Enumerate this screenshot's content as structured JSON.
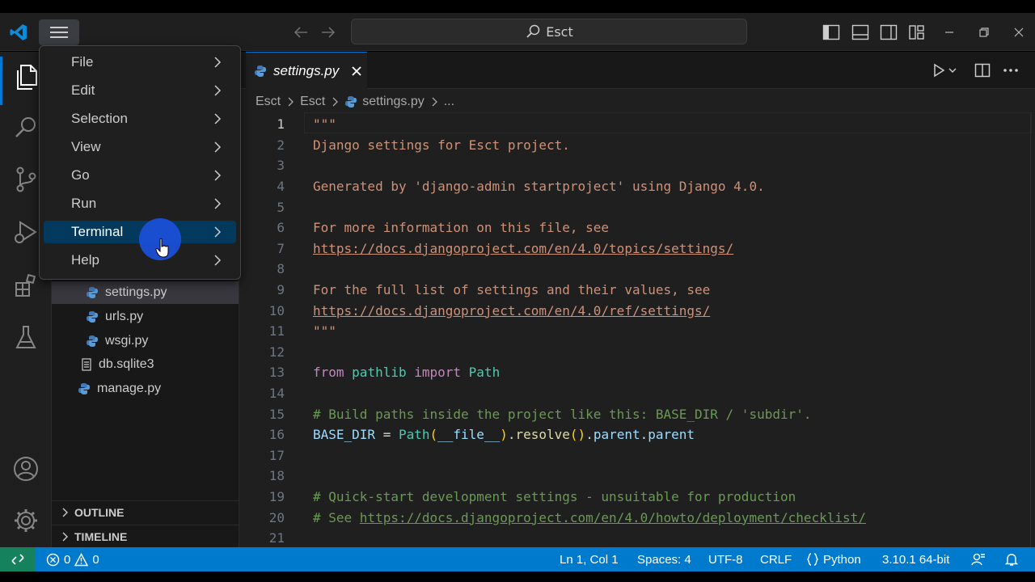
{
  "colors": {
    "accent": "#0078d4",
    "statusbar": "#007acc",
    "remote": "#16825d",
    "menu_highlight": "#04395e"
  },
  "titlebar": {
    "search_text": "Esct"
  },
  "menu": {
    "items": [
      {
        "label": "File"
      },
      {
        "label": "Edit"
      },
      {
        "label": "Selection"
      },
      {
        "label": "View"
      },
      {
        "label": "Go"
      },
      {
        "label": "Run"
      },
      {
        "label": "Terminal"
      },
      {
        "label": "Help"
      }
    ],
    "highlighted": "Terminal"
  },
  "explorer": {
    "files": [
      {
        "name": "settings.py",
        "icon": "python-icon",
        "selected": true
      },
      {
        "name": "urls.py",
        "icon": "python-icon"
      },
      {
        "name": "wsgi.py",
        "icon": "python-icon"
      },
      {
        "name": "db.sqlite3",
        "icon": "database-icon"
      },
      {
        "name": "manage.py",
        "icon": "python-icon"
      }
    ],
    "outline_label": "OUTLINE",
    "timeline_label": "TIMELINE"
  },
  "editor": {
    "tab_label": "settings.py",
    "breadcrumbs": [
      "Esct",
      "Esct",
      "settings.py",
      "..."
    ],
    "active_line": 1,
    "lines": [
      {
        "n": "1",
        "tokens": [
          {
            "t": "\"\"\"",
            "c": "s"
          }
        ]
      },
      {
        "n": "2",
        "tokens": [
          {
            "t": "Django settings for Esct project.",
            "c": "s"
          }
        ]
      },
      {
        "n": "3",
        "tokens": []
      },
      {
        "n": "4",
        "tokens": [
          {
            "t": "Generated by 'django-admin startproject' using Django 4.0.",
            "c": "s"
          }
        ]
      },
      {
        "n": "5",
        "tokens": []
      },
      {
        "n": "6",
        "tokens": [
          {
            "t": "For more information on this file, see",
            "c": "s"
          }
        ]
      },
      {
        "n": "7",
        "tokens": [
          {
            "t": "https://docs.djangoproject.com/en/4.0/topics/settings/",
            "c": "u"
          }
        ]
      },
      {
        "n": "8",
        "tokens": []
      },
      {
        "n": "9",
        "tokens": [
          {
            "t": "For the full list of settings and their values, see",
            "c": "s"
          }
        ]
      },
      {
        "n": "10",
        "tokens": [
          {
            "t": "https://docs.djangoproject.com/en/4.0/ref/settings/",
            "c": "u"
          }
        ]
      },
      {
        "n": "11",
        "tokens": [
          {
            "t": "\"\"\"",
            "c": "s"
          }
        ]
      },
      {
        "n": "12",
        "tokens": []
      },
      {
        "n": "13",
        "tokens": [
          {
            "t": "from ",
            "c": "k"
          },
          {
            "t": "pathlib ",
            "c": "n"
          },
          {
            "t": "import ",
            "c": "k"
          },
          {
            "t": "Path",
            "c": "n"
          }
        ]
      },
      {
        "n": "14",
        "tokens": []
      },
      {
        "n": "15",
        "tokens": [
          {
            "t": "# Build paths inside the project like this: BASE_DIR / 'subdir'.",
            "c": "c"
          }
        ]
      },
      {
        "n": "16",
        "tokens": [
          {
            "t": "BASE_DIR",
            "c": "v"
          },
          {
            "t": " = ",
            "c": "w"
          },
          {
            "t": "Path",
            "c": "n"
          },
          {
            "t": "(",
            "c": "p"
          },
          {
            "t": "__file__",
            "c": "v"
          },
          {
            "t": ")",
            "c": "p"
          },
          {
            "t": ".",
            "c": "w"
          },
          {
            "t": "resolve",
            "c": "f"
          },
          {
            "t": "()",
            "c": "p"
          },
          {
            "t": ".",
            "c": "w"
          },
          {
            "t": "parent",
            "c": "v"
          },
          {
            "t": ".",
            "c": "w"
          },
          {
            "t": "parent",
            "c": "v"
          }
        ]
      },
      {
        "n": "17",
        "tokens": []
      },
      {
        "n": "18",
        "tokens": []
      },
      {
        "n": "19",
        "tokens": [
          {
            "t": "# Quick-start development settings - unsuitable for production",
            "c": "c"
          }
        ]
      },
      {
        "n": "20",
        "tokens": [
          {
            "t": "# See ",
            "c": "c"
          },
          {
            "t": "https://docs.djangoproject.com/en/4.0/howto/deployment/checklist/",
            "c": "cu"
          }
        ]
      },
      {
        "n": "21",
        "tokens": []
      }
    ]
  },
  "statusbar": {
    "errors": "0",
    "warnings": "0",
    "position": "Ln 1, Col 1",
    "spaces": "Spaces: 4",
    "encoding": "UTF-8",
    "eol": "CRLF",
    "language": "Python",
    "interpreter": "3.10.1 64-bit"
  }
}
